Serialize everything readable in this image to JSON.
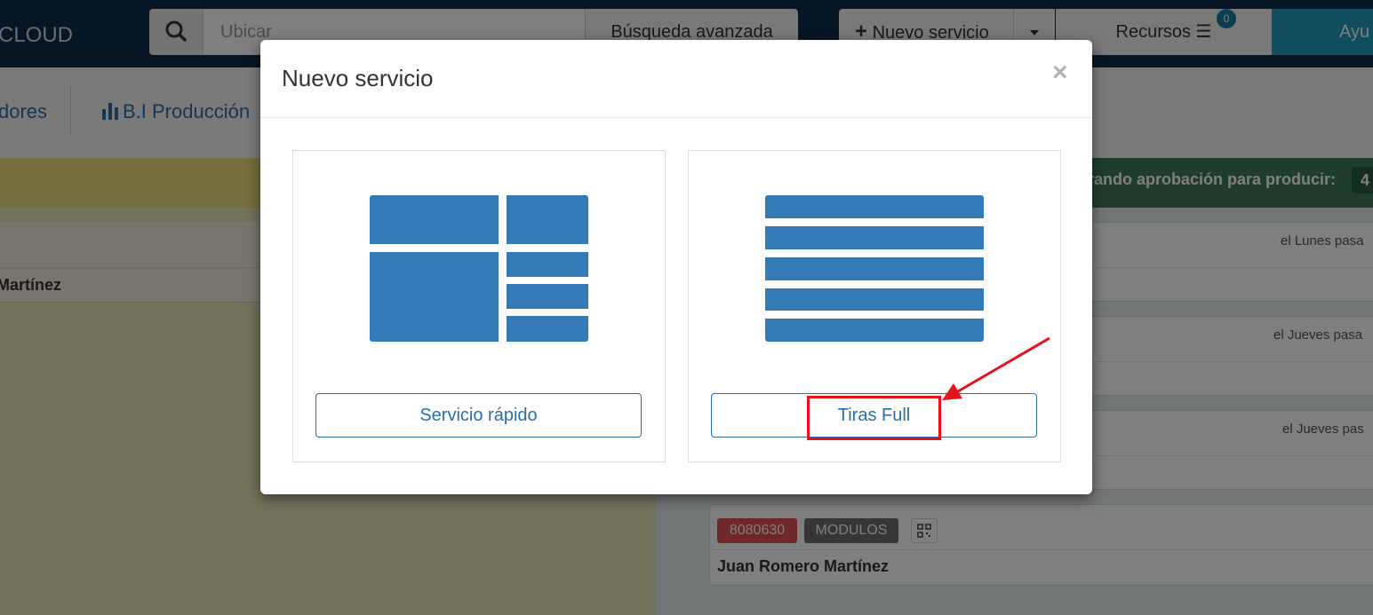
{
  "app": {
    "brand": "CLOUD"
  },
  "topbar": {
    "search_placeholder": "Ubicar",
    "advanced_search": "Búsqueda avanzada",
    "new_service": "Nuevo servicio",
    "resources": "Recursos",
    "resources_badge": "0",
    "help": "Ayu"
  },
  "subnav": {
    "item_a": "dores",
    "item_b": "B.I Producción"
  },
  "left_panel": {
    "card_name": "Martínez"
  },
  "right_panel": {
    "header_text": "rando aprobación para producir:",
    "header_count": "4",
    "cards": [
      {
        "time": "el Lunes pasa"
      },
      {
        "time": "el Jueves pasa"
      },
      {
        "time": "el Jueves pas"
      },
      {
        "code": "8080630",
        "type": "MODULOS",
        "name": "Juan Romero Martínez"
      }
    ]
  },
  "modal": {
    "title": "Nuevo servicio",
    "close_symbol": "×",
    "options": [
      {
        "label": "Servicio rápido"
      },
      {
        "label": "Tiras Full"
      }
    ]
  },
  "colors": {
    "accent": "#2a6ea8",
    "layout_blue": "#337ab7",
    "highlight_red": "#e3121b"
  }
}
